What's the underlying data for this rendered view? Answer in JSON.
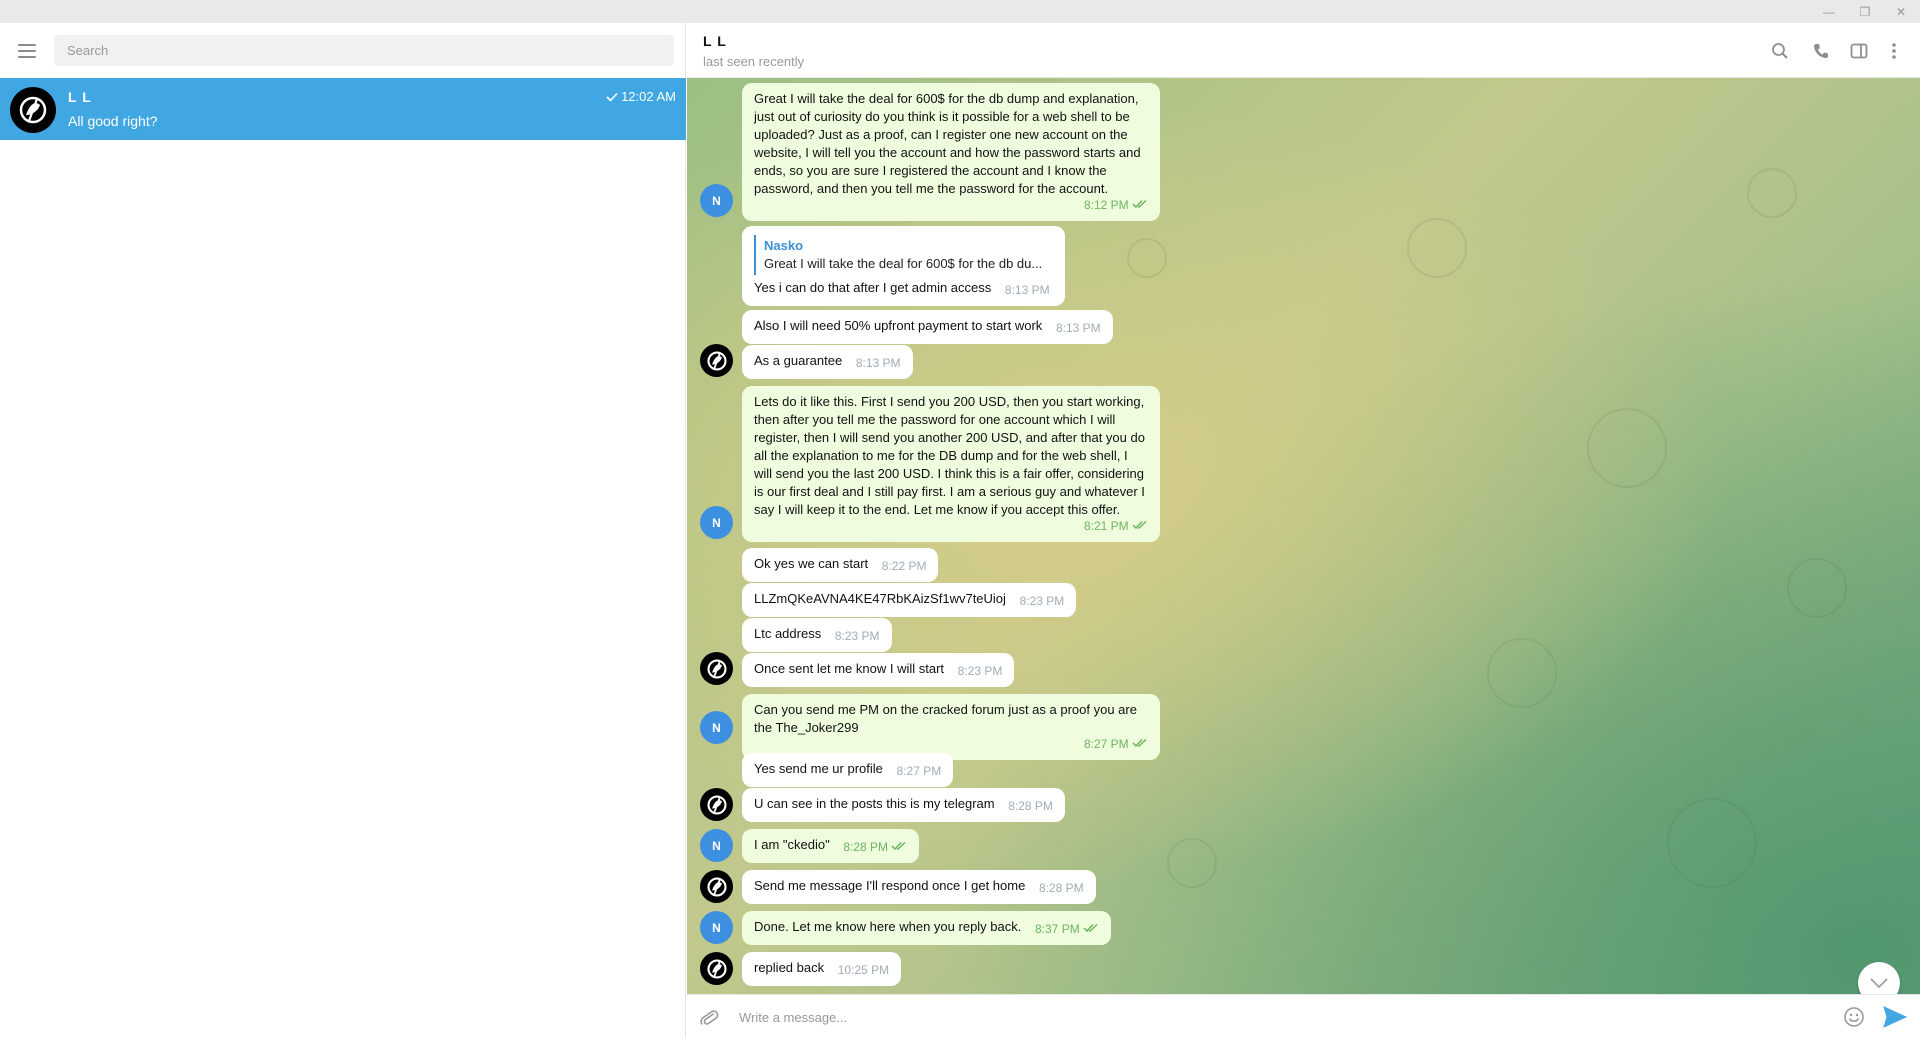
{
  "window": {
    "minimize": "—",
    "maximize": "❐",
    "close": "✕"
  },
  "sidebar": {
    "search_placeholder": "Search",
    "chats": [
      {
        "name": "L L",
        "preview": "All good right?",
        "time": "12:02 AM",
        "read": true
      }
    ]
  },
  "chat": {
    "peer_name": "L L",
    "peer_status": "last seen recently",
    "self_initial": "N",
    "composer_placeholder": "Write a message...",
    "messages": [
      {
        "dir": "out",
        "text": "Great I will take the deal for 600$ for the db dump and explanation, just out of curiosity do you think is it possible for a web shell to be uploaded? Just as a proof, can I register one new account on the website, I will tell you the account and how the password starts and ends, so you are sure I registered the account and I know the password, and then you tell me the password for the account.",
        "time": "8:12 PM"
      },
      {
        "dir": "in",
        "reply_author": "Nasko",
        "reply_text": "Great I will take the deal for 600$ for the db du...",
        "text": "Yes i can do that after I get admin access",
        "time": "8:13 PM"
      },
      {
        "dir": "in",
        "text": "Also I will need 50% upfront payment to start work",
        "time": "8:13 PM"
      },
      {
        "dir": "in",
        "text": "As a guarantee",
        "time": "8:13 PM"
      },
      {
        "dir": "out",
        "text": "Lets do it like this. First I send you 200 USD, then you start working, then after you tell me the password for one account which I will register, then I will send you another 200 USD, and after that you do all the explanation to me for the DB dump and for the web shell, I will send you the last 200 USD. I think this is a fair offer, considering is our first deal and I still pay first. I am a serious guy and whatever I say I will keep it to the end. Let me know if you accept this offer.",
        "time": "8:21 PM"
      },
      {
        "dir": "in",
        "text": "Ok yes we can start",
        "time": "8:22 PM"
      },
      {
        "dir": "in",
        "text": "LLZmQKeAVNA4KE47RbKAizSf1wv7teUioj",
        "time": "8:23 PM"
      },
      {
        "dir": "in",
        "text": "Ltc address",
        "time": "8:23 PM"
      },
      {
        "dir": "in",
        "text": "Once sent let me know I will start",
        "time": "8:23 PM"
      },
      {
        "dir": "out",
        "text": "Can you send me PM on the cracked forum just as a proof you are the The_Joker299",
        "time": "8:27 PM"
      },
      {
        "dir": "in",
        "text": "Yes send me ur profile",
        "time": "8:27 PM"
      },
      {
        "dir": "in",
        "text": "U can see in the posts this is my telegram",
        "time": "8:28 PM"
      },
      {
        "dir": "out",
        "text": "I am \"ckedio\"",
        "time": "8:28 PM"
      },
      {
        "dir": "in",
        "text": "Send me message I'll respond once I get home",
        "time": "8:28 PM"
      },
      {
        "dir": "out",
        "text": "Done. Let me know here when you reply back.",
        "time": "8:37 PM"
      },
      {
        "dir": "in",
        "text": "replied back",
        "time": "10:25 PM"
      }
    ]
  }
}
